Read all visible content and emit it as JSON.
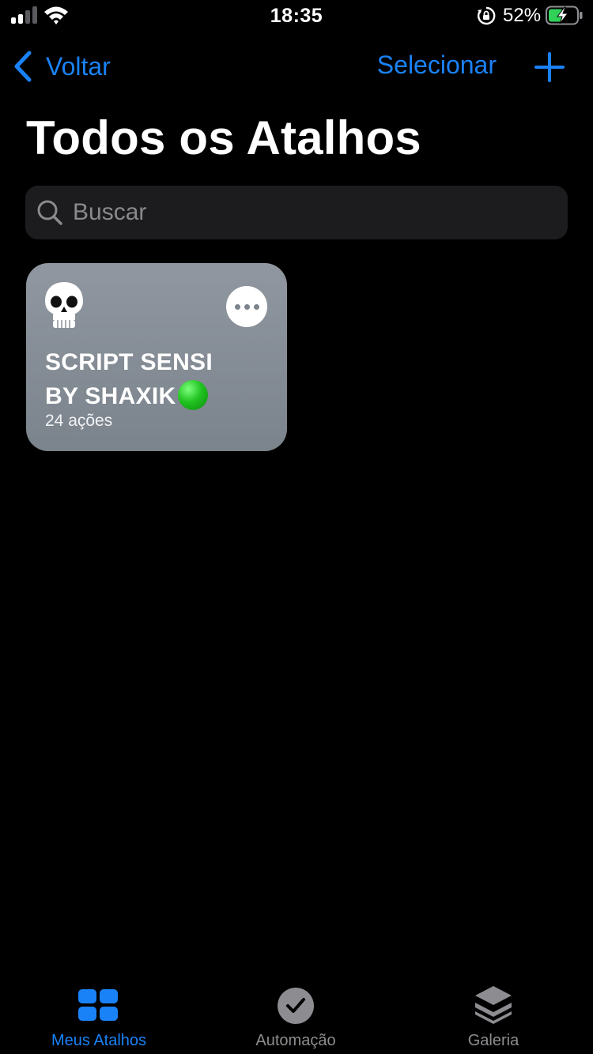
{
  "status_bar": {
    "time": "18:35",
    "battery_percent": "52%",
    "battery_level": 0.52,
    "charging": true,
    "icons": [
      "signal-icon",
      "wifi-icon",
      "rotation-lock-icon",
      "battery-icon"
    ]
  },
  "nav": {
    "back_label": "Voltar",
    "select_label": "Selecionar",
    "add_icon": "plus-icon"
  },
  "page": {
    "title": "Todos os Atalhos"
  },
  "search": {
    "placeholder": "Buscar",
    "value": ""
  },
  "shortcuts": [
    {
      "icon": "skull-icon",
      "name_line1": "SCRIPT SENSI",
      "name_line2": "BY SHAXIK",
      "emoji": "green-circle",
      "actions": "24 ações",
      "color": "#858d96"
    }
  ],
  "tabbar": {
    "items": [
      {
        "label": "Meus Atalhos",
        "icon": "grid-icon",
        "active": true
      },
      {
        "label": "Automação",
        "icon": "clock-check-icon",
        "active": false
      },
      {
        "label": "Galeria",
        "icon": "layers-icon",
        "active": false
      }
    ]
  },
  "colors": {
    "accent": "#1a82f7",
    "background": "#000000",
    "search_bg": "#1c1c1e",
    "inactive_tab": "#8d8d91"
  }
}
